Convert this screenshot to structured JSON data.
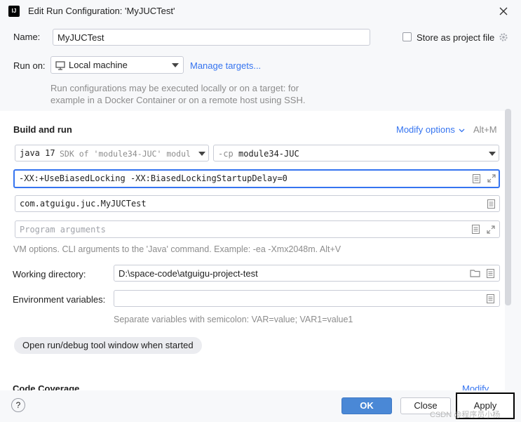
{
  "window": {
    "title": "Edit Run Configuration: 'MyJUCTest'",
    "app_icon": "IJ"
  },
  "name": {
    "label": "Name:",
    "value": "MyJUCTest"
  },
  "store": {
    "label": "Store as project file",
    "checked": false
  },
  "run_on": {
    "label": "Run on:",
    "selected": "Local machine",
    "manage_link": "Manage targets..."
  },
  "run_on_note": {
    "line1": "Run configurations may be executed locally or on a target: for",
    "line2": "example in a Docker Container or on a remote host using SSH."
  },
  "build": {
    "title": "Build and run",
    "modify_options": "Modify options",
    "shortcut": "Alt+M"
  },
  "sdk": {
    "java": "java 17",
    "detail": "SDK of 'module34-JUC' modul"
  },
  "classpath": {
    "prefix": "-cp",
    "module": "module34-JUC"
  },
  "vm_options": {
    "value": "-XX:+UseBiasedLocking -XX:BiasedLockingStartupDelay=0"
  },
  "main_class": {
    "value": "com.atguigu.juc.MyJUCTest"
  },
  "program_args": {
    "placeholder": "Program arguments"
  },
  "vm_hint": "VM options. CLI arguments to the 'Java' command. Example: -ea -Xmx2048m. Alt+V",
  "working_dir": {
    "label": "Working directory:",
    "value": "D:\\space-code\\atguigu-project-test"
  },
  "env_vars": {
    "label": "Environment variables:",
    "value": "",
    "hint": "Separate variables with semicolon: VAR=value; VAR1=value1"
  },
  "chip": {
    "label": "Open run/debug tool window when started"
  },
  "coverage": {
    "title": "Code Coverage",
    "modify": "Modify"
  },
  "footer": {
    "help": "?",
    "ok": "OK",
    "close": "Close",
    "apply": "Apply"
  },
  "watermark": "CSDN @程序员小杨",
  "colors": {
    "accent": "#3574f0",
    "ok_bg": "#4a88d6",
    "link": "#3574f0"
  }
}
